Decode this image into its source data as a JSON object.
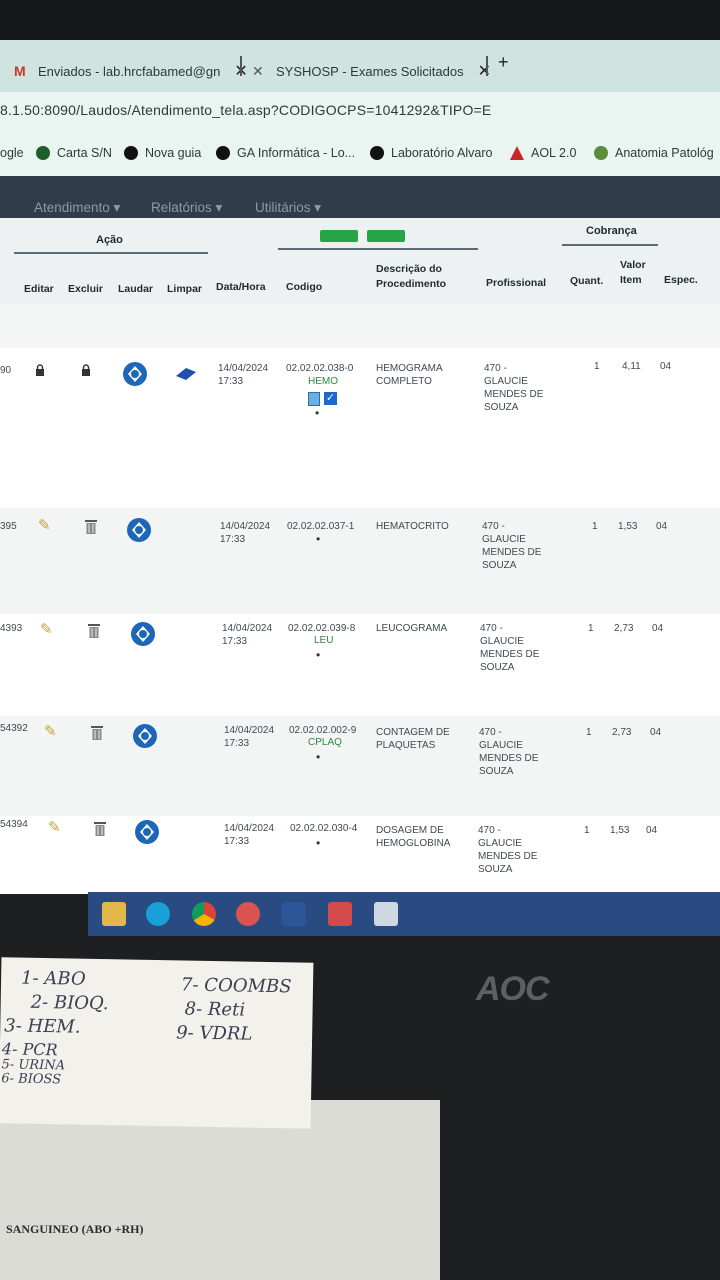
{
  "browser": {
    "tabs": [
      {
        "label": "Enviados - lab.hrcfabamed@gn"
      },
      {
        "label": "SYSHOSP - Exames Solicitados"
      }
    ],
    "new_tab": "+",
    "close_glyph": "✕",
    "url": "8.1.50:8090/Laudos/Atendimento_tela.asp?CODIGOCPS=1041292&TIPO=E",
    "bookmarks": [
      "ogle",
      "Carta S/N",
      "Nova guia",
      "GA Informática - Lo...",
      "Laboratório Alvaro",
      "AOL 2.0",
      "Anatomia Patológ"
    ]
  },
  "nav": {
    "items": [
      "Atendimento ▾",
      "Relatórios ▾",
      "Utilitários ▾"
    ]
  },
  "table": {
    "group_acao": "Ação",
    "group_cobranca": "Cobrança",
    "headers": {
      "editar": "Editar",
      "excluir": "Excluir",
      "laudar": "Laudar",
      "limpar": "Limpar",
      "datahora": "Data/Hora",
      "codigo": "Codigo",
      "descricao_1": "Descrição do",
      "descricao_2": "Procedimento",
      "profissional": "Profissional",
      "quant": "Quant.",
      "valor_1": "Valor",
      "valor_2": "Item",
      "espec": "Espec."
    },
    "rows": [
      {
        "id": "90",
        "date": "14/04/2024",
        "time": "17:33",
        "code": "02.02.02.038-0",
        "sub": "HEMO",
        "desc1": "HEMOGRAMA",
        "desc2": "COMPLETO",
        "prof1": "470 -",
        "prof2": "GLAUCIE",
        "prof3": "MENDES DE",
        "prof4": "SOUZA",
        "qty": "1",
        "value": "4,11",
        "spec": "04"
      },
      {
        "id": "395",
        "date": "14/04/2024",
        "time": "17:33",
        "code": "02.02.02.037-1",
        "sub": "",
        "desc1": "HEMATOCRITO",
        "desc2": "",
        "prof1": "470 -",
        "prof2": "GLAUCIE",
        "prof3": "MENDES DE",
        "prof4": "SOUZA",
        "qty": "1",
        "value": "1,53",
        "spec": "04"
      },
      {
        "id": "4393",
        "date": "14/04/2024",
        "time": "17:33",
        "code": "02.02.02.039-8",
        "sub": "LEU",
        "desc1": "LEUCOGRAMA",
        "desc2": "",
        "prof1": "470 -",
        "prof2": "GLAUCIE",
        "prof3": "MENDES DE",
        "prof4": "SOUZA",
        "qty": "1",
        "value": "2,73",
        "spec": "04"
      },
      {
        "id": "54392",
        "date": "14/04/2024",
        "time": "17:33",
        "code": "02.02.02.002-9",
        "sub": "CPLAQ",
        "desc1": "CONTAGEM DE",
        "desc2": "PLAQUETAS",
        "prof1": "470 -",
        "prof2": "GLAUCIE",
        "prof3": "MENDES DE",
        "prof4": "SOUZA",
        "qty": "1",
        "value": "2,73",
        "spec": "04"
      },
      {
        "id": "54394",
        "date": "14/04/2024",
        "time": "17:33",
        "code": "02.02.02.030-4",
        "sub": "",
        "desc1": "DOSAGEM DE",
        "desc2": "HEMOGLOBINA",
        "prof1": "470 -",
        "prof2": "GLAUCIE",
        "prof3": "MENDES DE",
        "prof4": "SOUZA",
        "qty": "1",
        "value": "1,53",
        "spec": "04"
      }
    ]
  },
  "monitor_brand": "AOC",
  "note": {
    "left": [
      "1- ABO",
      "2- BIOQ.",
      "3- HEM.",
      "4- PCR",
      "5- URINA",
      "6- BIOSS"
    ],
    "right": [
      "7- COOMBS",
      "8- Reti",
      "9- VDRL"
    ]
  },
  "paper_print": "SANGUINEO (ABO +RH)"
}
